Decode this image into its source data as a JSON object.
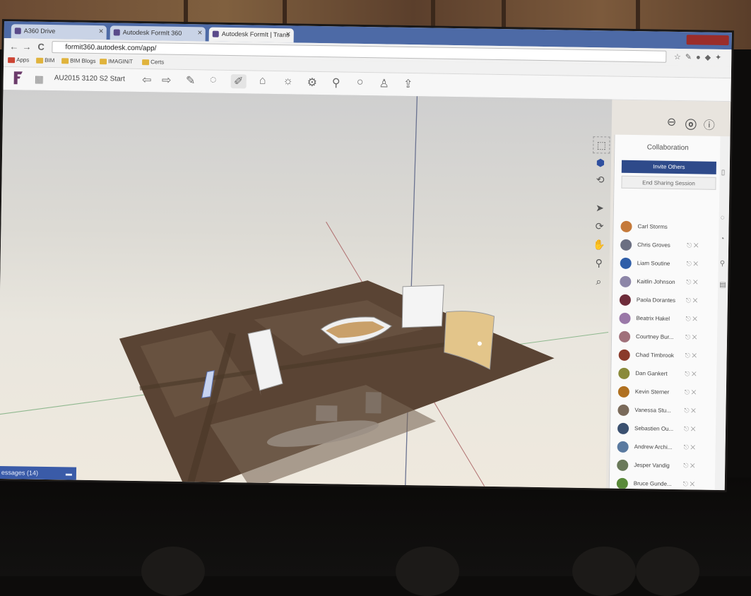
{
  "browser": {
    "tabs": [
      {
        "label": "A360 Drive"
      },
      {
        "label": "Autodesk FormIt 360"
      },
      {
        "label": "Autodesk FormIt | Trans"
      }
    ],
    "url": "formit360.autodesk.com/app/",
    "bookmarks": [
      "Apps",
      "BIM",
      "BIM Blogs",
      "IMAGINiT",
      "Certs"
    ]
  },
  "app": {
    "file_name": "AU2015 3120 S2 Start",
    "toolbar_icons": [
      "undo-icon",
      "redo-icon",
      "pencil-icon",
      "shape-icon",
      "sketch-icon",
      "add-level-icon",
      "sun-icon",
      "settings-icon",
      "location-icon",
      "circle-icon",
      "person-icon",
      "share-icon"
    ],
    "subtoolbar_icons": [
      "boolean-icon",
      "solar-icon",
      "paint-icon",
      "tag-icon",
      "layers-icon"
    ],
    "top_right_icons": [
      "minus-circle-icon",
      "user-icon",
      "info-icon"
    ]
  },
  "collaboration": {
    "title": "Collaboration",
    "invite_label": "Invite Others",
    "end_label": "End Sharing Session",
    "users": [
      {
        "name": "Carl Storms",
        "color": "#c57a3a"
      },
      {
        "name": "Chris Groves",
        "color": "#6b6f82"
      },
      {
        "name": "Liam Soutine",
        "color": "#2f5ea8"
      },
      {
        "name": "Kaitlin Johnson",
        "color": "#8d86a8"
      },
      {
        "name": "Paola Dorantes",
        "color": "#6e2c3a"
      },
      {
        "name": "Beatrix Hakel",
        "color": "#9a78a8"
      },
      {
        "name": "Courtney Bur...",
        "color": "#a0707a"
      },
      {
        "name": "Chad Timbrook",
        "color": "#8a3a2a"
      },
      {
        "name": "Dan Gankert",
        "color": "#8a8a3a"
      },
      {
        "name": "Kevin Sterner",
        "color": "#b07020"
      },
      {
        "name": "Vanessa Stu...",
        "color": "#7a6a5a"
      },
      {
        "name": "Sebastien Ou...",
        "color": "#3a5070"
      },
      {
        "name": "Andrew Archi...",
        "color": "#5a7aa0"
      },
      {
        "name": "Jesper Vandig",
        "color": "#6a7a5a"
      },
      {
        "name": "Bruce Gunde...",
        "color": "#5a8a3a"
      }
    ]
  },
  "messages": {
    "label": "essages (14)"
  }
}
